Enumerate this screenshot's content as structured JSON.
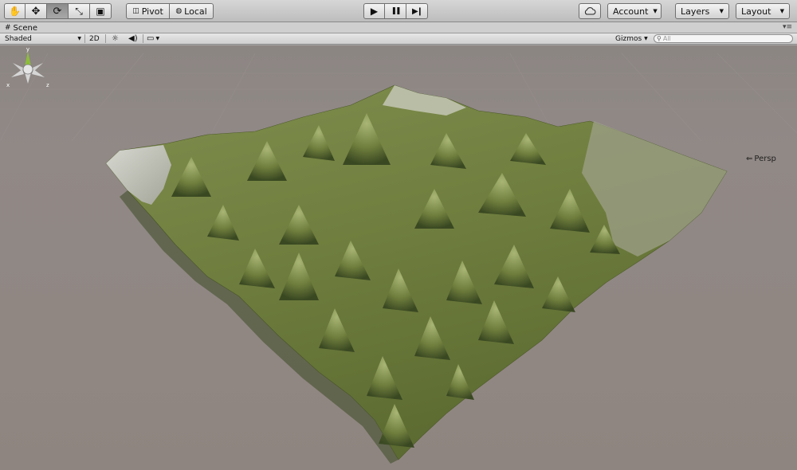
{
  "toolbar": {
    "tools": [
      {
        "icon": "hand-icon",
        "glyph": "✋",
        "active": false
      },
      {
        "icon": "move-icon",
        "glyph": "✥",
        "active": false
      },
      {
        "icon": "rotate-icon",
        "glyph": "⟳",
        "active": true
      },
      {
        "icon": "scale-icon",
        "glyph": "⤡",
        "active": false
      },
      {
        "icon": "rect-tool-icon",
        "glyph": "▣",
        "active": false
      }
    ],
    "pivot_label": "Pivot",
    "local_label": "Local",
    "play_glyph": "▶",
    "pause_glyph": "❚❚",
    "step_glyph": "▶❙",
    "account_label": "Account",
    "layers_label": "Layers",
    "layout_label": "Layout"
  },
  "scene_tab": {
    "label": "Scene",
    "menu_glyph": "▾≡"
  },
  "scene_bar": {
    "shading_label": "Shaded",
    "mode_2d_label": "2D",
    "gizmos_label": "Gizmos",
    "search_placeholder": "All"
  },
  "viewport": {
    "persp_label": "Persp",
    "gizmo_axes": {
      "x": "x",
      "y": "y",
      "z": "z"
    }
  },
  "colors": {
    "sky": "#8f8783",
    "terrain_light": "#8e9c5a",
    "terrain_dark": "#3b4a22",
    "snow": "#d4d4d2",
    "gizmo_y": "#8dbd3b",
    "gizmo_x": "#d86b5a",
    "gizmo_z": "#5a7bd8"
  }
}
